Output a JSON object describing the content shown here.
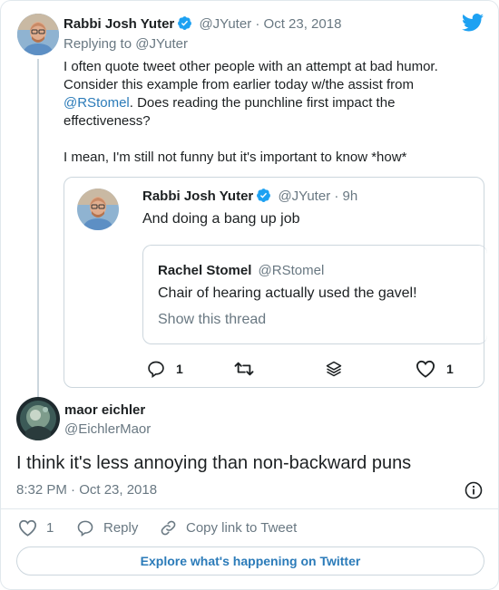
{
  "colors": {
    "link": "#2b7bb9",
    "grey": "#697882",
    "border": "#ccd6dd",
    "twitter_blue": "#1da1f2"
  },
  "parent_tweet": {
    "author_name": "Rabbi Josh Yuter",
    "handle": "@JYuter",
    "date": "· Oct 23, 2018",
    "replying_to_prefix": "Replying to ",
    "replying_to_handle": "@JYuter",
    "text_line1": "I often quote tweet other people with an attempt at bad humor.",
    "text_line2": "Consider this example from earlier today w/the assist from",
    "mention": "@RStomel",
    "text_line3_rest": ". Does reading the punchline first impact the",
    "text_line4": "effectiveness?",
    "text_line5": "I mean, I'm still not funny but it's important to know *how*"
  },
  "quoted_tweet": {
    "author_name": "Rabbi Josh Yuter",
    "handle": "@JYuter",
    "time": "· 9h",
    "text": "And doing a bang up job",
    "inner": {
      "author_name": "Rachel Stomel",
      "handle": "@RStomel",
      "text": "Chair of hearing actually used the gavel!",
      "show_thread": "Show this thread"
    },
    "actions": {
      "replies": "1",
      "likes": "1"
    }
  },
  "main_tweet": {
    "author_name": "maor eichler",
    "handle": "@EichlerMaor",
    "text": "I think it's less annoying than non-backward puns",
    "timestamp": "8:32 PM · Oct 23, 2018",
    "like_count": "1",
    "reply_label": "Reply",
    "copy_link_label": "Copy link to Tweet"
  },
  "explore_label": "Explore what's happening on Twitter",
  "icons": [
    "twitter-bird-icon",
    "verified-icon",
    "reply-icon",
    "retweet-icon",
    "stack-icon",
    "heart-icon",
    "info-icon",
    "link-icon"
  ]
}
